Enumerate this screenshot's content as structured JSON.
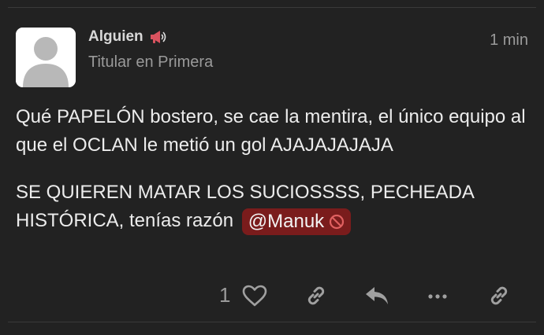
{
  "post": {
    "author": "Alguien",
    "subtitle": "Titular en Primera",
    "time": "1 min",
    "paragraph1": "Qué PAPELÓN bostero, se cae la mentira, el único equipo al que el OCLAN le metió un gol AJAJAJAJAJA",
    "paragraph2_text": "SE QUIEREN MATAR LOS SUCIOSSSS, PECHEADA HISTÓRICA, tenías razón",
    "mention": "@Manuk",
    "icons": {
      "avatar": "default-user-avatar",
      "author_badge": "megaphone-icon",
      "mention_badge": "no-entry-icon"
    }
  },
  "actions": {
    "like_count": "1",
    "items": [
      "heart-icon",
      "link-icon",
      "reply-icon",
      "more-icon",
      "share-link-icon"
    ]
  },
  "colors": {
    "background": "#222222",
    "mention_bg": "#7a1c1c",
    "muted_text": "#9a9a9a",
    "icon": "#a0a0a0"
  }
}
